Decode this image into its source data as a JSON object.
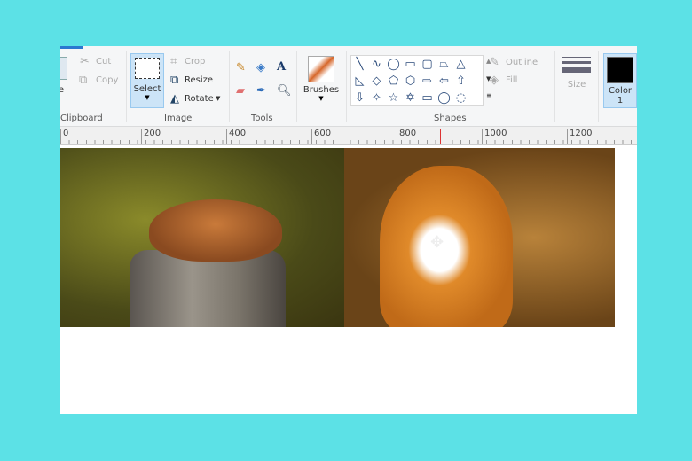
{
  "ribbon": {
    "clipboard": {
      "paste_partial": "te",
      "cut": "Cut",
      "copy": "Copy",
      "group": "Clipboard"
    },
    "image": {
      "select": "Select",
      "crop": "Crop",
      "resize": "Resize",
      "rotate": "Rotate",
      "group": "Image"
    },
    "tools": {
      "group": "Tools"
    },
    "brushes": {
      "label": "Brushes"
    },
    "shapes": {
      "group": "Shapes",
      "outline": "Outline",
      "fill": "Fill",
      "glyphs": [
        "╲",
        "∿",
        "◯",
        "▭",
        "▢",
        "⏢",
        "△",
        "◺",
        "◇",
        "⬠",
        "⬡",
        "⇨",
        "⇦",
        "⇧",
        "⇩",
        "✧",
        "☆",
        "✡",
        "▭",
        "◯",
        "◌"
      ]
    },
    "size": {
      "label": "Size"
    },
    "color1": {
      "label": "Color",
      "number": "1",
      "color": "#000000"
    }
  },
  "ruler": {
    "ticks": [
      "0",
      "200",
      "400",
      "600",
      "800",
      "1000",
      "1200"
    ]
  },
  "canvas": {
    "images": [
      "sleeping fox on tree stump",
      "fox sitting in grass"
    ]
  },
  "colors": {
    "background": "#5ce1e6",
    "accent": "#2b79d0"
  }
}
